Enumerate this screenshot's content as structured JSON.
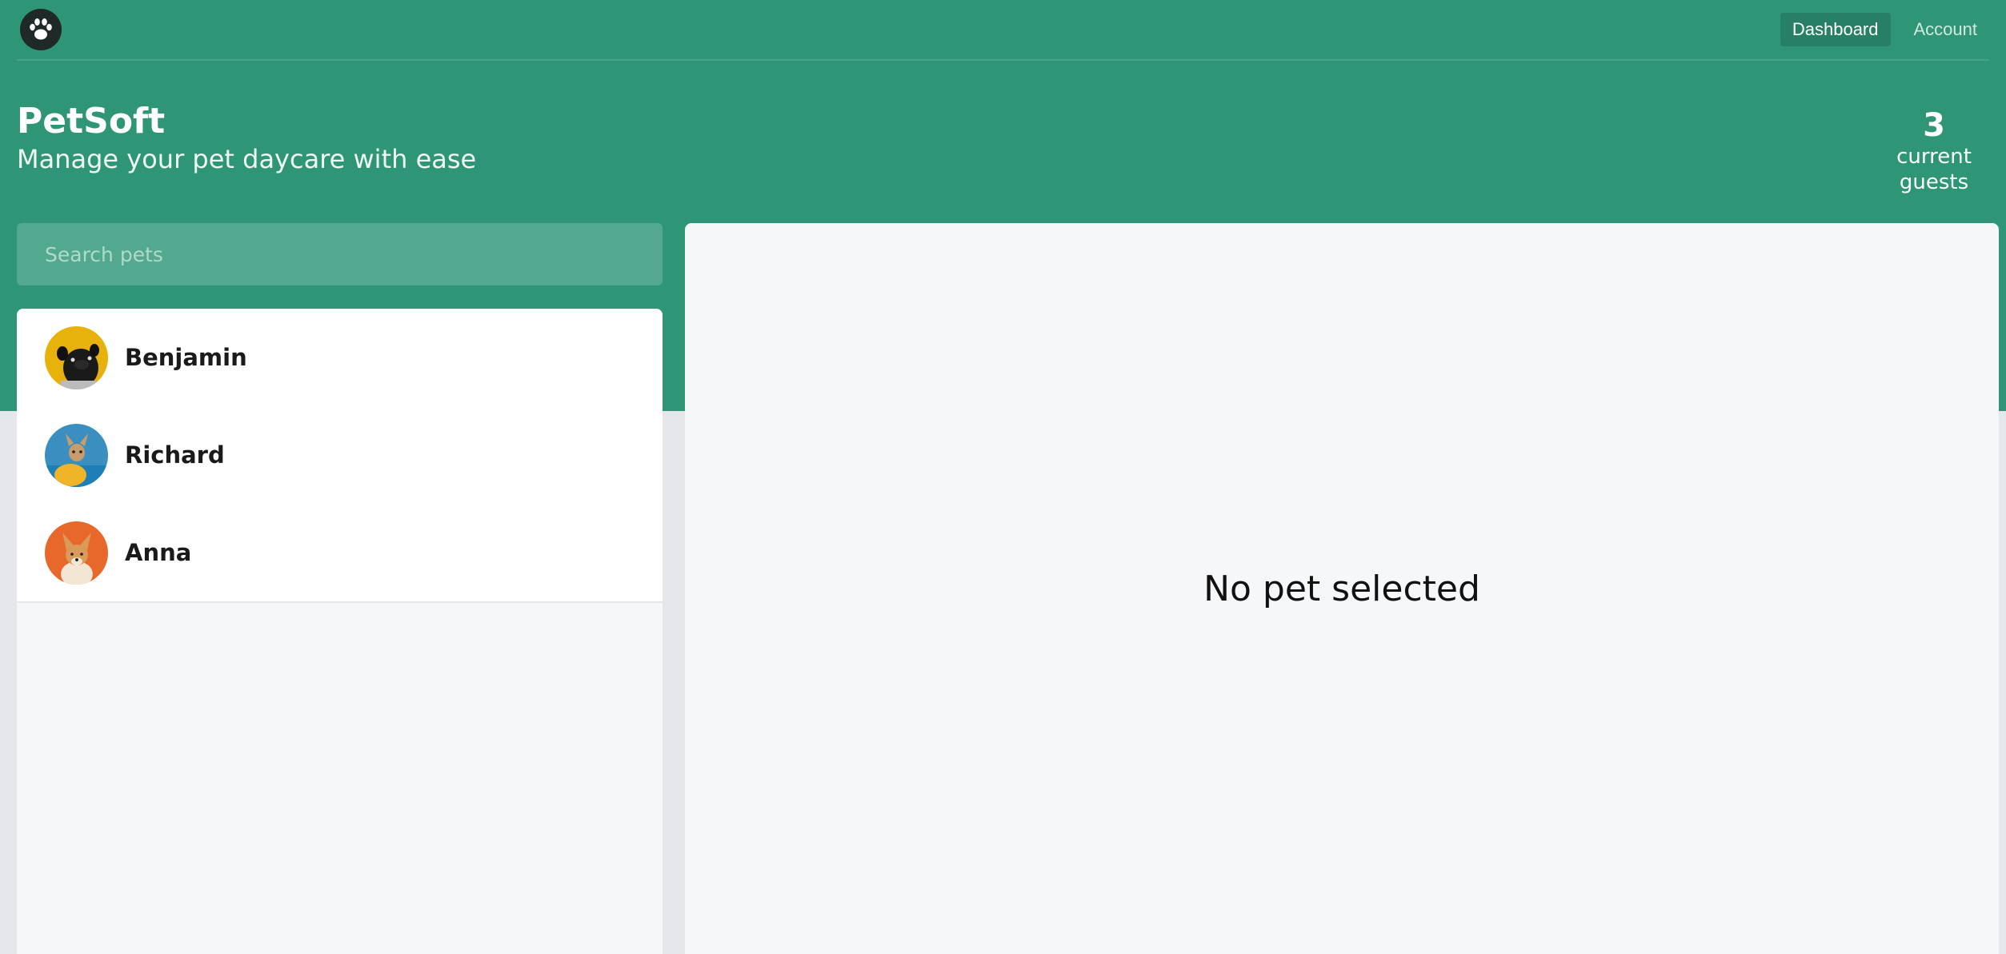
{
  "nav": {
    "logo_icon": "paw-icon",
    "links": [
      {
        "label": "Dashboard",
        "active": true
      },
      {
        "label": "Account",
        "active": false
      }
    ]
  },
  "branding": {
    "title": "PetSoft",
    "subtitle": "Manage your pet daycare with ease"
  },
  "stats": {
    "count": "3",
    "label": "current guests"
  },
  "search": {
    "placeholder": "Search pets"
  },
  "pets": [
    {
      "name": "Benjamin",
      "avatar_icon": "dog-photo-pug",
      "avatar_color": "#e8b20c"
    },
    {
      "name": "Richard",
      "avatar_icon": "dog-photo-chihuahua",
      "avatar_color": "#3a8fc0"
    },
    {
      "name": "Anna",
      "avatar_icon": "dog-photo-corgi",
      "avatar_color": "#e8672a"
    }
  ],
  "details": {
    "empty_message": "No pet selected"
  },
  "colors": {
    "brand": "#2e9677",
    "background": "#e5e7eb",
    "panel": "#f6f7f9"
  }
}
